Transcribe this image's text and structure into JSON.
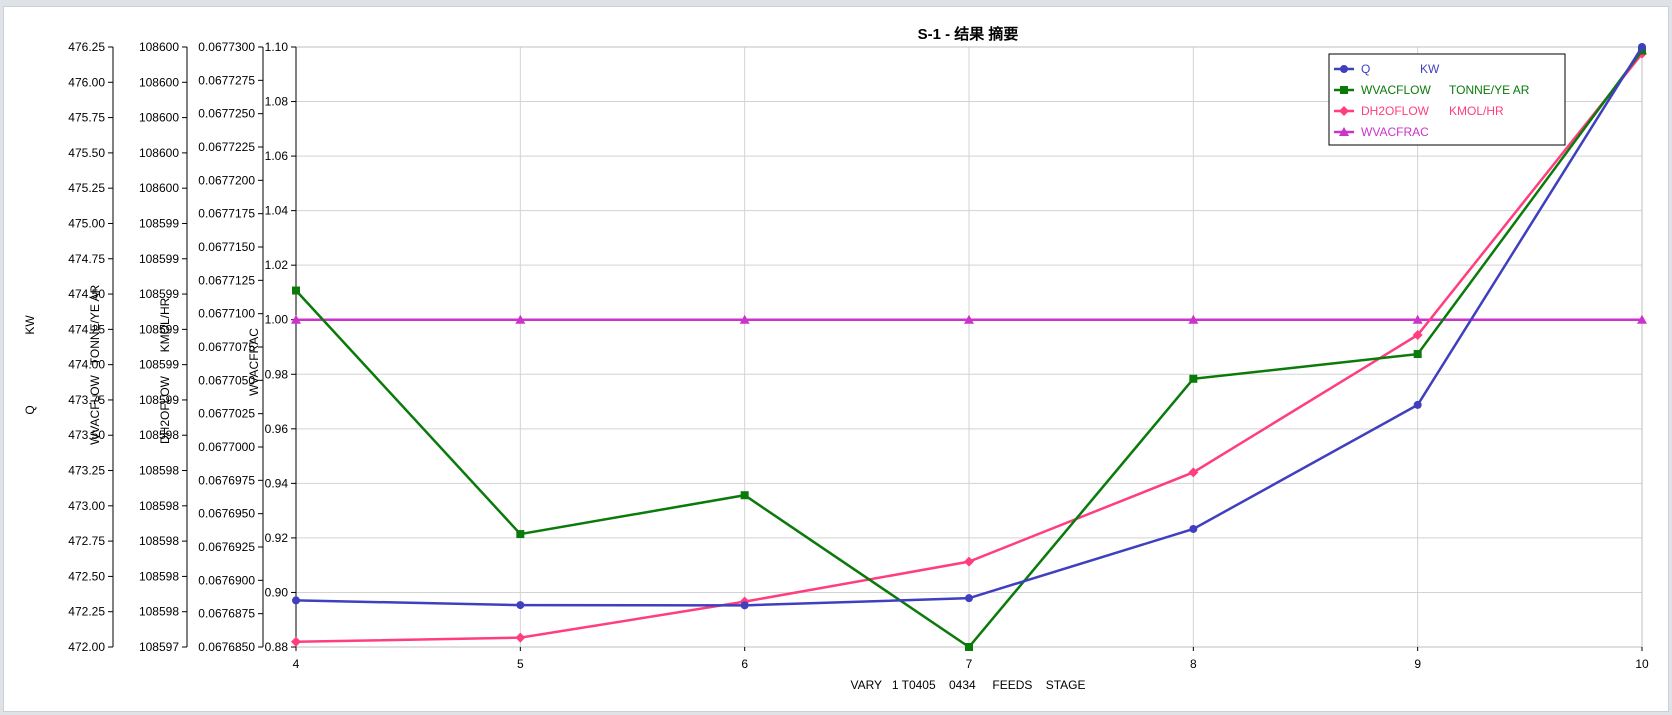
{
  "chart_data": {
    "type": "line",
    "title": "S-1 - 结果 摘要",
    "xlabel": "VARY   1 T0405    0434     FEEDS    STAGE",
    "x": [
      4,
      5,
      6,
      7,
      8,
      9,
      10
    ],
    "xlim": [
      4,
      10
    ],
    "grid": true,
    "legend_position": "top-right",
    "axes": [
      {
        "id": "q",
        "label_lines": [
          "Q",
          "KW"
        ],
        "range": [
          472.0,
          476.25
        ],
        "ticks": [
          "472.00",
          "472.25",
          "472.50",
          "472.75",
          "473.00",
          "473.25",
          "473.50",
          "473.75",
          "474.00",
          "474.25",
          "474.50",
          "474.75",
          "475.00",
          "475.25",
          "475.50",
          "475.75",
          "476.00",
          "476.25"
        ]
      },
      {
        "id": "wvacflow",
        "label_lines": [
          "WVACFLOW",
          "TONNE/YE AR"
        ],
        "range": [
          0,
          17
        ],
        "ticks": [
          "108597",
          "108598",
          "108598",
          "108598",
          "108598",
          "108598",
          "108598",
          "108599",
          "108599",
          "108599",
          "108599",
          "108599",
          "108599",
          "108600",
          "108600",
          "108600",
          "108600",
          "108600"
        ]
      },
      {
        "id": "dh2oflow",
        "label_lines": [
          "DH2OFLOW",
          "KMOL/HR"
        ],
        "range": [
          0.067685,
          0.06773
        ],
        "ticks": [
          "0.0676850",
          "0.0676875",
          "0.0676900",
          "0.0676925",
          "0.0676950",
          "0.0676975",
          "0.0677000",
          "0.0677025",
          "0.0677050",
          "0.0677075",
          "0.0677100",
          "0.0677125",
          "0.0677150",
          "0.0677175",
          "0.0677200",
          "0.0677225",
          "0.0677250",
          "0.0677275",
          "0.0677300"
        ]
      },
      {
        "id": "wvacfrac",
        "label_lines": [
          "WVACFRAC"
        ],
        "range": [
          0.88,
          1.1
        ],
        "ticks": [
          "0.88",
          "0.90",
          "0.92",
          "0.94",
          "0.96",
          "0.98",
          "1.00",
          "1.02",
          "1.04",
          "1.06",
          "1.08",
          "1.10"
        ]
      }
    ],
    "series": [
      {
        "name": "Q",
        "unit": "KW",
        "color": "#3f3fbf",
        "marker": "circle",
        "axis": "q",
        "values": [
          472.33,
          472.297,
          472.295,
          472.346,
          472.836,
          473.715,
          476.25
        ]
      },
      {
        "name": "WVACFLOW",
        "unit": "TONNE/YE AR",
        "color": "#0a7a0a",
        "marker": "square",
        "axis": "wvacflow",
        "values": [
          10.1,
          3.2,
          4.3,
          0.0,
          7.6,
          8.3,
          16.9
        ]
      },
      {
        "name": "DH2OFLOW",
        "unit": "KMOL/HR",
        "color": "#ff3d7f",
        "marker": "diamond",
        "axis": "dh2oflow",
        "values": [
          0.06768539,
          0.0676857,
          0.0676884,
          0.0676914,
          0.0676981,
          0.0677084,
          0.0677295
        ]
      },
      {
        "name": "WVACFRAC",
        "unit": "",
        "color": "#cc33cc",
        "marker": "triangle",
        "axis": "wvacfrac",
        "values": [
          1.0,
          1.0,
          1.0,
          1.0,
          1.0,
          1.0,
          1.0
        ]
      }
    ]
  }
}
